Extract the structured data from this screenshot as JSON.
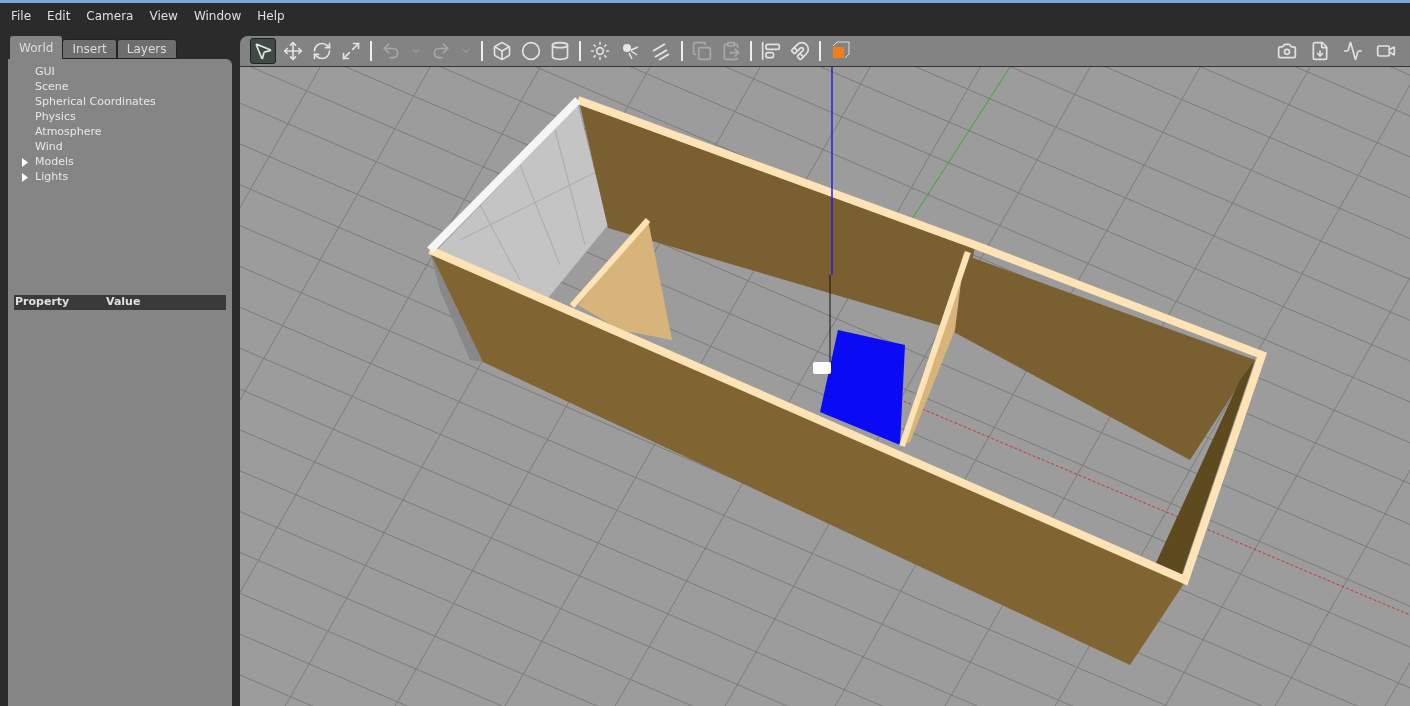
{
  "menu": [
    "File",
    "Edit",
    "Camera",
    "View",
    "Window",
    "Help"
  ],
  "tabs": [
    {
      "label": "World",
      "selected": true
    },
    {
      "label": "Insert",
      "selected": false
    },
    {
      "label": "Layers",
      "selected": false
    }
  ],
  "tree": [
    {
      "label": "GUI"
    },
    {
      "label": "Scene"
    },
    {
      "label": "Spherical Coordinates"
    },
    {
      "label": "Physics"
    },
    {
      "label": "Atmosphere"
    },
    {
      "label": "Wind"
    },
    {
      "label": "Models",
      "expanded": false
    },
    {
      "label": "Lights",
      "expanded": false
    }
  ],
  "properties": {
    "columns": [
      "Property",
      "Value"
    ]
  },
  "toolbar": [
    {
      "kind": "select",
      "selected": true,
      "disabled": false
    },
    {
      "kind": "translate",
      "selected": false,
      "disabled": false
    },
    {
      "kind": "rotate",
      "selected": false,
      "disabled": false
    },
    {
      "kind": "scale",
      "selected": false,
      "disabled": false
    },
    {
      "kind": "separator"
    },
    {
      "kind": "undo",
      "selected": false,
      "disabled": true
    },
    {
      "kind": "dropdown",
      "selected": false,
      "disabled": true
    },
    {
      "kind": "redo",
      "selected": false,
      "disabled": true
    },
    {
      "kind": "dropdown",
      "selected": false,
      "disabled": true
    },
    {
      "kind": "separator"
    },
    {
      "kind": "box",
      "selected": false,
      "disabled": false
    },
    {
      "kind": "sphere",
      "selected": false,
      "disabled": false
    },
    {
      "kind": "cylinder",
      "selected": false,
      "disabled": false
    },
    {
      "kind": "separator"
    },
    {
      "kind": "sun",
      "selected": false,
      "disabled": false
    },
    {
      "kind": "pointlight",
      "selected": false,
      "disabled": false
    },
    {
      "kind": "directional",
      "selected": false,
      "disabled": false
    },
    {
      "kind": "separator"
    },
    {
      "kind": "copy",
      "selected": false,
      "disabled": true
    },
    {
      "kind": "paste",
      "selected": false,
      "disabled": true
    },
    {
      "kind": "separator"
    },
    {
      "kind": "align",
      "selected": false,
      "disabled": false
    },
    {
      "kind": "magnet",
      "selected": false,
      "disabled": false
    },
    {
      "kind": "separator"
    },
    {
      "kind": "view",
      "selected": false,
      "disabled": false
    }
  ],
  "right_toolbar": [
    {
      "kind": "camera"
    },
    {
      "kind": "log"
    },
    {
      "kind": "plot"
    },
    {
      "kind": "video"
    }
  ]
}
